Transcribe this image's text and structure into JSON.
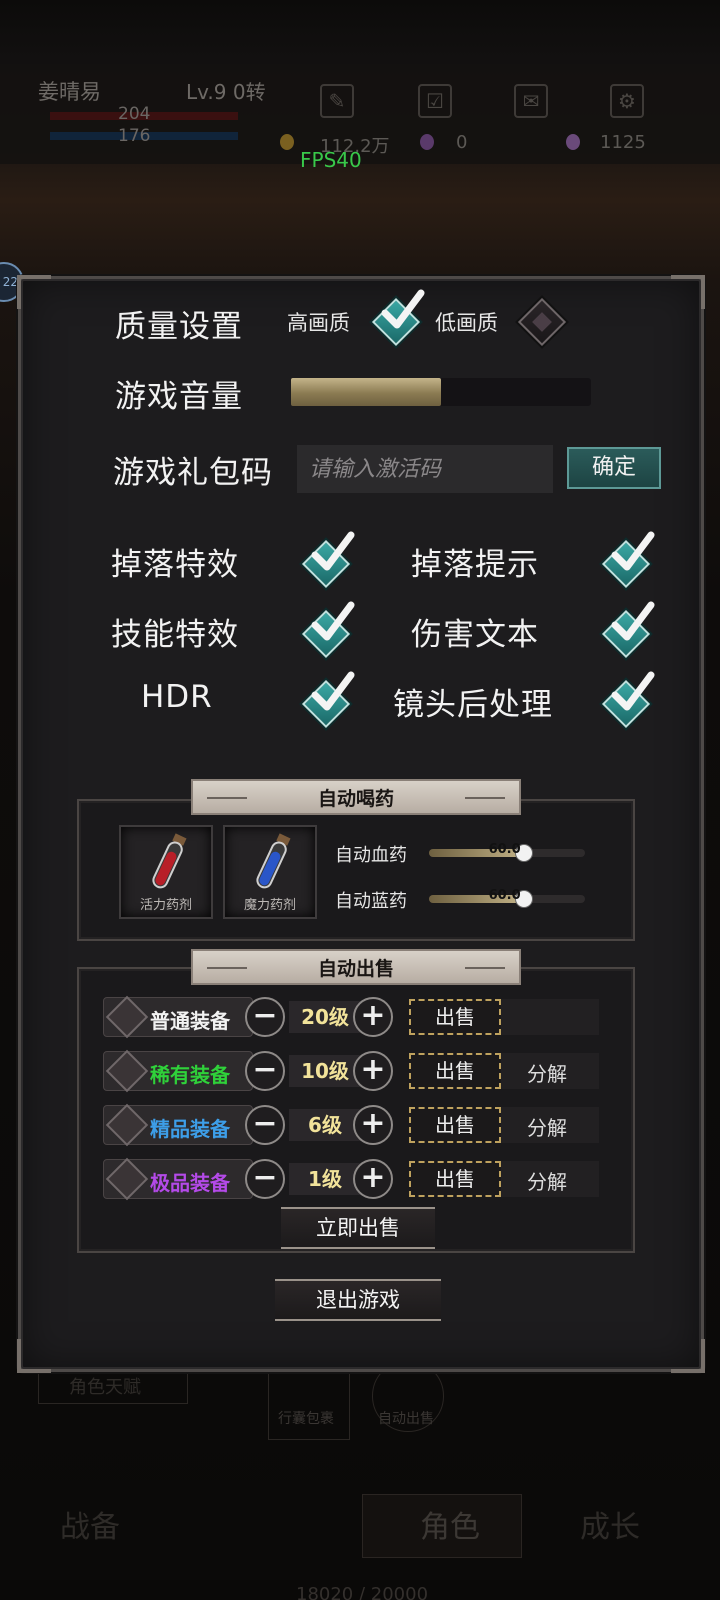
{
  "background": {
    "player_name": "姜晴易",
    "level": "Lv.9 0转",
    "hp": "204",
    "mp": "176",
    "gold": "112.2万",
    "gems": "0",
    "crystals": "1125",
    "fps": "FPS40",
    "avatar_badge": "22",
    "under_panel": {
      "talent": "角色天赋",
      "bag": "行囊包裹",
      "auto_sell": "自动出售"
    },
    "tabs": [
      "战备",
      "角色",
      "成长"
    ],
    "exp": "18020 / 20000"
  },
  "settings": {
    "quality": {
      "label": "质量设置",
      "high_label": "高画质",
      "high_checked": true,
      "low_label": "低画质",
      "low_checked": false
    },
    "volume": {
      "label": "游戏音量",
      "value": 0.5
    },
    "gift_code": {
      "label": "游戏礼包码",
      "placeholder": "请输入激活码",
      "confirm": "确定"
    },
    "toggles": [
      {
        "label": "掉落特效",
        "checked": true
      },
      {
        "label": "掉落提示",
        "checked": true
      },
      {
        "label": "技能特效",
        "checked": true
      },
      {
        "label": "伤害文本",
        "checked": true
      },
      {
        "label": "HDR",
        "checked": true
      },
      {
        "label": "镜头后处理",
        "checked": true
      }
    ],
    "auto_potion": {
      "title": "自动喝药",
      "potions": [
        {
          "name": "活力药剂",
          "color": "#b81f28"
        },
        {
          "name": "魔力药剂",
          "color": "#2a56c8"
        }
      ],
      "hp_label": "自动血药",
      "hp_value": "60.0",
      "hp_level": 0.6,
      "mp_label": "自动蓝药",
      "mp_value": "60.0",
      "mp_level": 0.6
    },
    "auto_sell": {
      "title": "自动出售",
      "rows": [
        {
          "name": "普通装备",
          "color": "#f2f2f2",
          "level": "20级",
          "sell": "出售",
          "decompose": ""
        },
        {
          "name": "稀有装备",
          "color": "#2fd13a",
          "level": "10级",
          "sell": "出售",
          "decompose": "分解"
        },
        {
          "name": "精品装备",
          "color": "#3d9ee8",
          "level": "6级",
          "sell": "出售",
          "decompose": "分解"
        },
        {
          "name": "极品装备",
          "color": "#b44ae8",
          "level": "1级",
          "sell": "出售",
          "decompose": "分解"
        }
      ],
      "minus": "−",
      "plus": "+",
      "sell_now": "立即出售"
    },
    "exit": "退出游戏"
  }
}
